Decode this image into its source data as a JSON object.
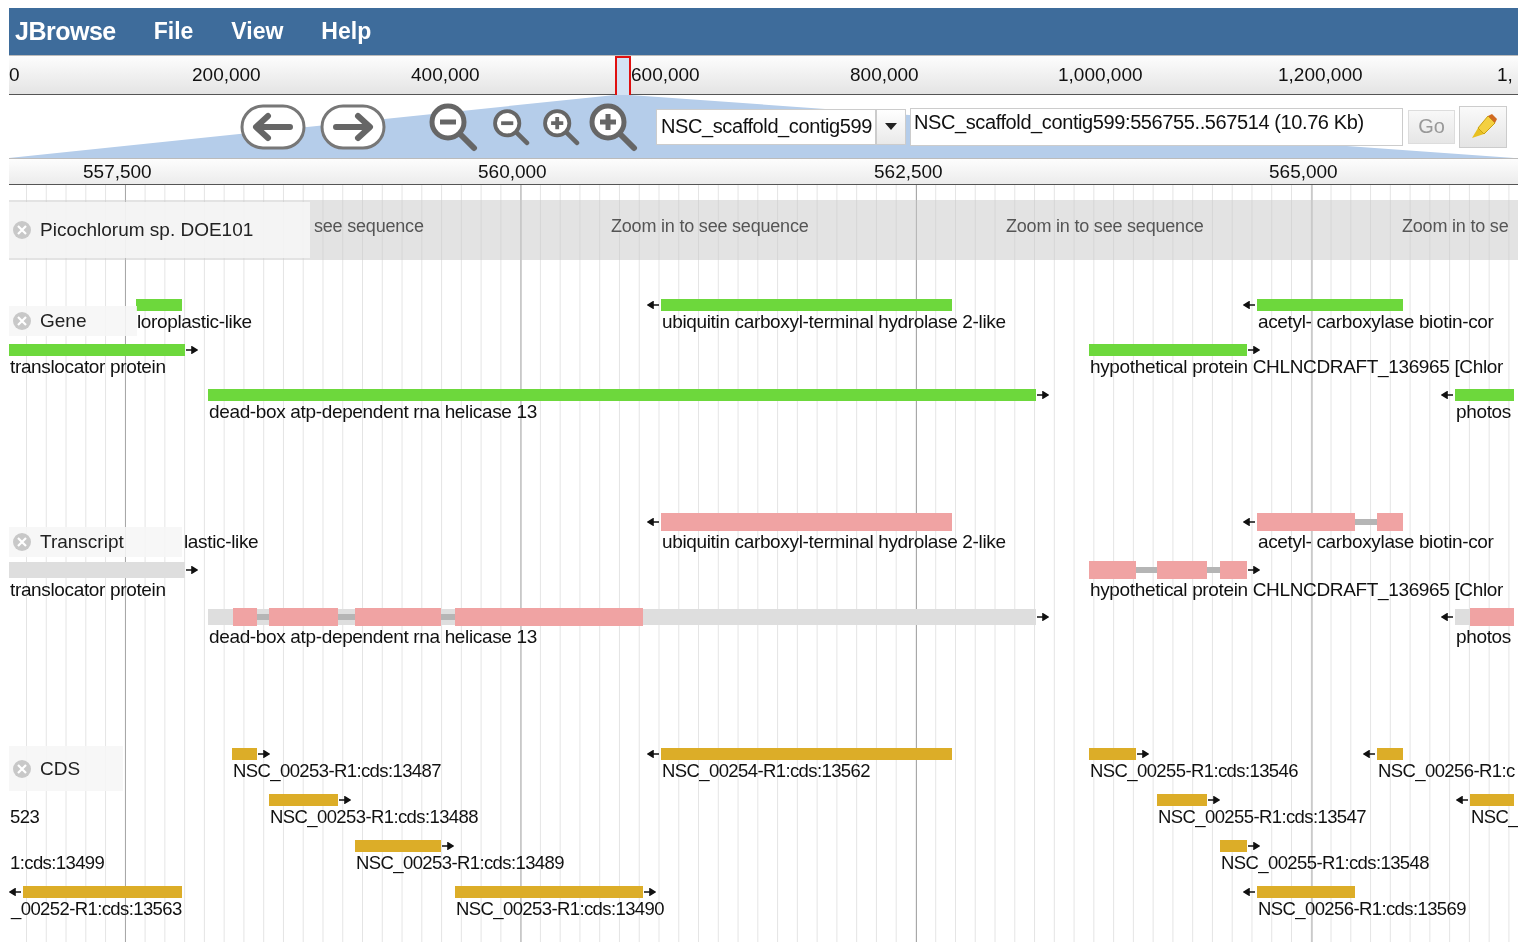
{
  "menu_bar": {
    "brand": "JBrowse",
    "items": [
      {
        "label": "File"
      },
      {
        "label": "View"
      },
      {
        "label": "Help"
      }
    ]
  },
  "overview": {
    "ticks": [
      "0",
      "200,000",
      "400,000",
      "600,000",
      "800,000",
      "1,000,000",
      "1,200,000",
      "1,"
    ]
  },
  "navigation": {
    "reference": "NSC_scaffold_contig599",
    "location": "NSC_scaffold_contig599:556755..567514 (10.76 Kb)",
    "go_button": "Go"
  },
  "ruler": {
    "ticks": [
      "557,500",
      "560,000",
      "562,500",
      "565,000"
    ]
  },
  "tracks": [
    {
      "kind": "sequence",
      "label": "Picochlorum sp. DOE101",
      "texts": [
        "see sequence",
        "Zoom in to see sequence",
        "Zoom in to see sequence",
        "Zoom in to se"
      ]
    },
    {
      "kind": "gene",
      "label": "Gene",
      "rows": [
        [
          {
            "label": "loroplastic-like",
            "kind": "plain"
          },
          {
            "label": "ubiquitin carboxyl-terminal hydrolase 2-like",
            "kind": "reverse"
          },
          {
            "label": "acetyl- carboxylase biotin-cor",
            "kind": "reverse"
          }
        ],
        [
          {
            "label": "translocator protein",
            "kind": "forward"
          },
          {
            "label": "hypothetical protein CHLNCDRAFT_136965 [Chlor",
            "kind": "forward"
          }
        ],
        [
          {
            "label": "dead-box atp-dependent rna helicase 13",
            "kind": "forward"
          },
          {
            "label": "photos",
            "kind": "reverse"
          }
        ]
      ]
    },
    {
      "kind": "transcript",
      "label": "Transcript",
      "rows": [
        [
          {
            "label": "lastic-like",
            "kind": "label_only"
          },
          {
            "label": "ubiquitin carboxyl-terminal hydrolase 2-like",
            "kind": "reverse"
          },
          {
            "label": "acetyl- carboxylase biotin-cor",
            "kind": "reverse"
          }
        ],
        [
          {
            "label": "translocator protein",
            "kind": "forward"
          },
          {
            "label": "hypothetical protein CHLNCDRAFT_136965 [Chlor",
            "kind": "forward"
          }
        ],
        [
          {
            "label": "dead-box atp-dependent rna helicase 13",
            "kind": "forward"
          },
          {
            "label": "photos",
            "kind": "reverse"
          }
        ]
      ]
    },
    {
      "kind": "cds",
      "label": "CDS",
      "rows": [
        [
          {
            "label": "NSC_00253-R1:cds:13487",
            "kind": "forward"
          },
          {
            "label": "NSC_00254-R1:cds:13562",
            "kind": "reverse"
          },
          {
            "label": "NSC_00255-R1:cds:13546",
            "kind": "forward"
          },
          {
            "label": "NSC_00256-R1:c",
            "kind": "reverse"
          }
        ],
        [
          {
            "label": "523",
            "kind": "label_only"
          },
          {
            "label": "NSC_00253-R1:cds:13488",
            "kind": "forward"
          },
          {
            "label": "NSC_00255-R1:cds:13547",
            "kind": "forward"
          },
          {
            "label": "NSC_",
            "kind": "reverse"
          }
        ],
        [
          {
            "label": "1:cds:13499",
            "kind": "label_only"
          },
          {
            "label": "NSC_00253-R1:cds:13489",
            "kind": "forward"
          },
          {
            "label": "NSC_00255-R1:cds:13548",
            "kind": "forward"
          }
        ],
        [
          {
            "label": "_00252-R1:cds:13563",
            "kind": "reverse"
          },
          {
            "label": "NSC_00253-R1:cds:13490",
            "kind": "forward"
          },
          {
            "label": "NSC_00256-R1:cds:13569",
            "kind": "reverse"
          }
        ]
      ]
    }
  ]
}
